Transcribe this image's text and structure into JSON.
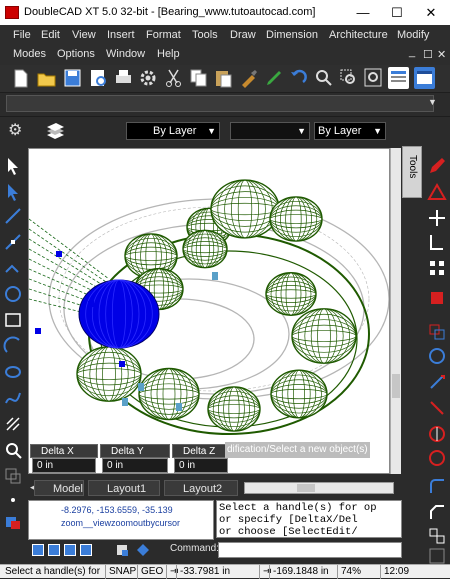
{
  "window": {
    "title": "DoubleCAD XT 5.0 32-bit - [Bearing_www.tutoautocad.com]",
    "minimize_glyph": "—",
    "maximize_glyph": "☐",
    "close_glyph": "✕"
  },
  "menu": {
    "row1": [
      "File",
      "Edit",
      "View",
      "Insert",
      "Format",
      "Tools",
      "Draw",
      "Dimension",
      "Architecture",
      "Modify"
    ],
    "row2": [
      "Modes",
      "Options",
      "Window",
      "Help"
    ],
    "mdi_buttons": [
      "_",
      "☐",
      "✕"
    ]
  },
  "properties": {
    "layer_combo": "By Layer",
    "color_combo": "",
    "linetype_combo": "By Layer"
  },
  "tools_tab": "Tools",
  "delta": {
    "x_label": "Delta X",
    "x_value": "0 in",
    "y_label": "Delta Y",
    "y_value": "0 in",
    "z_label": "Delta Z",
    "z_value": "0 in"
  },
  "tooltip": "dification/Select a new object(s)",
  "layout_tabs": [
    "Model",
    "Layout1",
    "Layout2"
  ],
  "history": [
    "-8.2976, -153.6559, -35.139",
    "zoom__viewzoomoutbycursor"
  ],
  "prompt_lines": [
    "Select a handle(s) for op",
    "  or specify [DeltaX/Del",
    "  or choose [SelectEdit/"
  ],
  "command_label": "Command:",
  "status": {
    "message": "Select a handle(s) for",
    "snap": "SNAP",
    "geo": "GEO",
    "x": "-33.7981 in",
    "y": "-169.1848 in",
    "zoom": "74%",
    "time": "12:09"
  },
  "colors": {
    "wire_green": "#1f5a00",
    "selected_blue": "#0000e6",
    "ring_gray": "#b5b5b5"
  }
}
